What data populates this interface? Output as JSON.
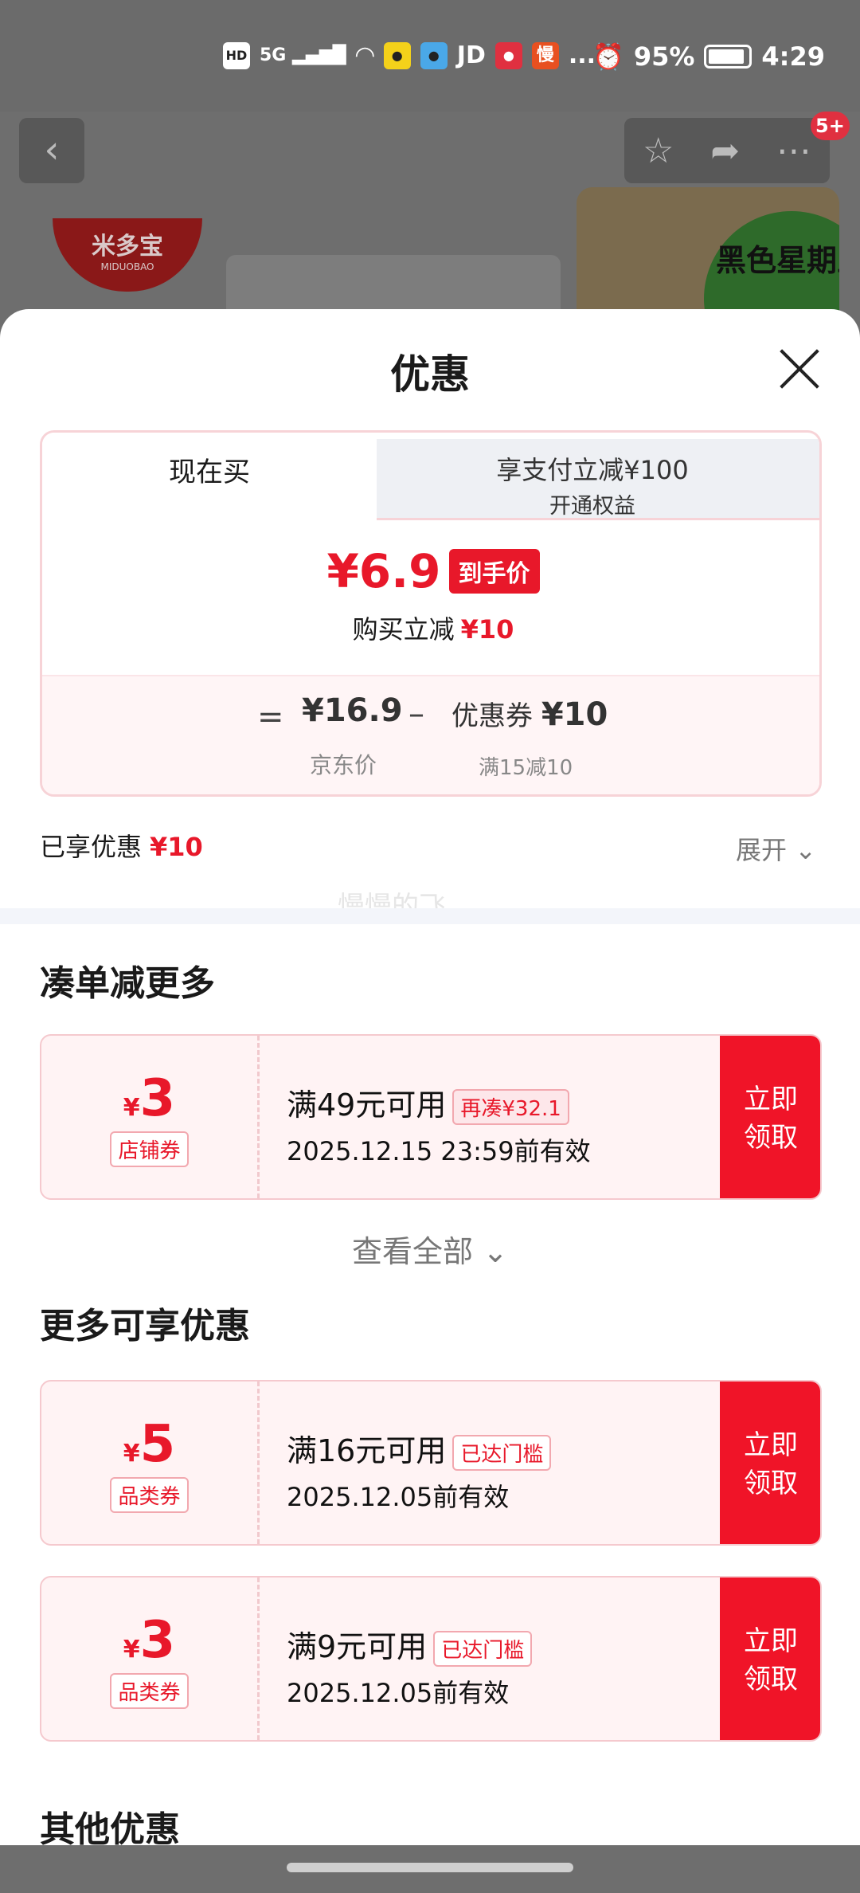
{
  "status_bar": {
    "left_icons": [
      "HD",
      "5G",
      "wifi-icon",
      "app-icon-1",
      "app-icon-2",
      "JD",
      "app-icon-3",
      "慢",
      "..."
    ],
    "battery": "95%",
    "time": "4:29"
  },
  "background_page": {
    "brand_name": "米多宝",
    "brand_sub": "MIDUOBAO",
    "notification_count": "5+",
    "promo_tag": "黑色星期五"
  },
  "sheet": {
    "title": "优惠",
    "tabs": {
      "now": "现在买",
      "other_line1": "享支付立减¥100",
      "other_line2": "开通权益"
    },
    "final_price": "¥6.9",
    "final_price_tag": "到手价",
    "buy_discount_label": "购买立减",
    "buy_discount_value": "¥10",
    "breakdown": {
      "equals": "=",
      "jd_price": "¥16.9",
      "jd_price_label": "京东价",
      "minus": "–",
      "coupon_label": "优惠券",
      "coupon_value": "¥10",
      "coupon_condition": "满15减10"
    },
    "enjoyed_label": "已享优惠",
    "enjoyed_value": "¥10",
    "expand_label": "展开",
    "watermark": "慢慢的飞"
  },
  "section_bundle": {
    "title": "凑单减更多",
    "coupons": [
      {
        "symbol": "¥",
        "amount": "3",
        "type": "店铺券",
        "condition": "满49元可用",
        "tag": "再凑¥32.1",
        "expiry": "2025.12.15 23:59前有效",
        "button": "立即领取"
      }
    ],
    "view_all": "查看全部"
  },
  "section_more": {
    "title": "更多可享优惠",
    "coupons": [
      {
        "symbol": "¥",
        "amount": "5",
        "type": "品类券",
        "condition": "满16元可用",
        "tag": "已达门槛",
        "expiry": "2025.12.05前有效",
        "button": "立即领取"
      },
      {
        "symbol": "¥",
        "amount": "3",
        "type": "品类券",
        "condition": "满9元可用",
        "tag": "已达门槛",
        "expiry": "2025.12.05前有效",
        "button": "立即领取"
      }
    ]
  },
  "section_other": {
    "title": "其他优惠"
  },
  "colors": {
    "accent_red": "#e8182a",
    "button_red": "#f01428",
    "coupon_bg": "#fff3f4",
    "overlay_gray": "#6e6e6e"
  }
}
